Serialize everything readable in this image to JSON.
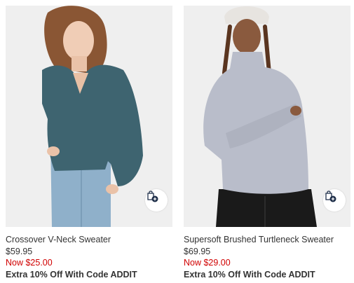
{
  "products": [
    {
      "name": "Crossover V-Neck Sweater",
      "original_price": "$59.95",
      "sale_price": "Now $25.00",
      "promo": "Extra 10% Off With Code ADDIT",
      "sweater_color": "#3e6470",
      "image_icon": "product-photo-woman-teal-sweater"
    },
    {
      "name": "Supersoft Brushed Turtleneck Sweater",
      "original_price": "$69.95",
      "sale_price": "Now $29.00",
      "promo": "Extra 10% Off With Code ADDIT",
      "sweater_color": "#b9bdca",
      "image_icon": "product-photo-woman-grey-turtleneck"
    }
  ],
  "colors": {
    "sale_red": "#d00000",
    "text_dark": "#333333",
    "image_bg": "#efefef",
    "bag_icon_navy": "#1f2f4a"
  },
  "icons": {
    "quick_add": "shopping-bag-plus-icon"
  }
}
